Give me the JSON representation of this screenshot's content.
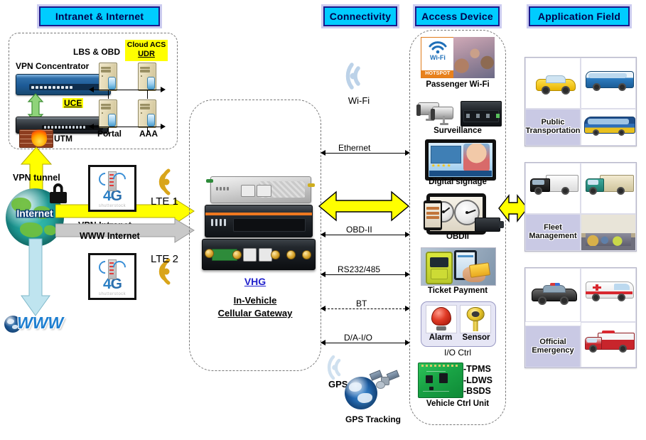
{
  "columns": {
    "intranet": "Intranet & Internet",
    "connectivity": "Connectivity",
    "access_device": "Access Device",
    "application_field": "Application Field"
  },
  "intranet": {
    "vpn_concentrator": "VPN Concentrator",
    "lbs_obd": "LBS & OBD",
    "cloud_acs": "Cloud ACS",
    "udr": "UDR",
    "uce": "UCE",
    "utm": "UTM",
    "portal": "Portal",
    "aaa": "AAA",
    "vpn_tunnel": "VPN tunnel",
    "internet": "Internet",
    "www": "WWW",
    "vpn_intranet_arrow": "VPN Intranet",
    "www_internet_arrow": "WWW Internet",
    "lte1": "LTE 1",
    "lte2": "LTE 2",
    "lte_thumb_4g": "4G",
    "lte_thumb_watermark": "shutterstock"
  },
  "gateway": {
    "model": "VHG",
    "title_line1": "In-Vehicle",
    "title_line2": "Cellular  Gateway"
  },
  "connectivity": {
    "wifi": "Wi-Fi",
    "links": [
      {
        "label": "Ethernet",
        "style": "solid"
      },
      {
        "label": "OBD-II",
        "style": "solid"
      },
      {
        "label": "RS232/485",
        "style": "solid"
      },
      {
        "label": "BT",
        "style": "dashed"
      },
      {
        "label": "D/A-I/O",
        "style": "solid"
      }
    ],
    "gps": "GPS",
    "gps_tracking": "GPS Tracking"
  },
  "access_devices": [
    {
      "name": "Passenger Wi-Fi"
    },
    {
      "name": "Surveillance"
    },
    {
      "name": "Digital signage"
    },
    {
      "name": "OBDII"
    },
    {
      "name": "Ticket Payment"
    },
    {
      "name": "I/O Ctrl"
    },
    {
      "name": "Vehicle Ctrl Unit"
    }
  ],
  "access_extra": {
    "wifi_logo_text": "Wi-Fi",
    "hotspot": "HOTSPOT",
    "alarm": "Alarm",
    "sensor": "Sensor",
    "vcu_features": [
      "-TPMS",
      "-LDWS",
      "-BSDS"
    ]
  },
  "application_fields": [
    {
      "label_line1": "Public",
      "label_line2": "Transportation"
    },
    {
      "label_line1": "Fleet",
      "label_line2": "Management"
    },
    {
      "label_line1": "Official",
      "label_line2": "Emergency"
    }
  ],
  "colors": {
    "banner_fill": "#00ccff",
    "banner_border": "#1a1a8c",
    "banner_glow": "#ccccf0",
    "yellow_arrow": "#ffff00",
    "green_arrow": "#8fd37a",
    "gray_arrow": "#c9c9c9",
    "cyan_arrow": "#bfe4ef",
    "lte_amber": "#d9a51a",
    "wifi_blue": "#bcd2e8",
    "highlight": "#ffff00",
    "link_blue": "#2222cc"
  }
}
